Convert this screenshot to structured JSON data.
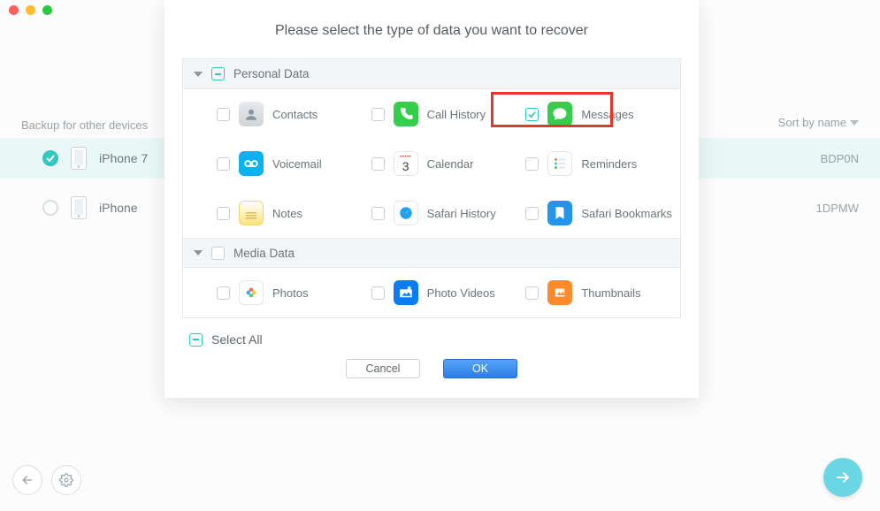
{
  "sidebar": {
    "backup_label": "Backup for other devices",
    "sort_label": "Sort by name",
    "devices": [
      {
        "name": "iPhone 7",
        "selected": true,
        "code": "BDP0N"
      },
      {
        "name": "iPhone",
        "selected": false,
        "code": "1DPMW"
      }
    ]
  },
  "modal": {
    "title": "Please select the type of data you want to recover",
    "groups": [
      {
        "title": "Personal Data",
        "state": "mixed",
        "rows": [
          [
            {
              "id": "contacts",
              "label": "Contacts",
              "checked": false
            },
            {
              "id": "call-history",
              "label": "Call History",
              "checked": false
            },
            {
              "id": "messages",
              "label": "Messages",
              "checked": true,
              "highlight": true
            }
          ],
          [
            {
              "id": "voicemail",
              "label": "Voicemail",
              "checked": false
            },
            {
              "id": "calendar",
              "label": "Calendar",
              "checked": false
            },
            {
              "id": "reminders",
              "label": "Reminders",
              "checked": false
            }
          ],
          [
            {
              "id": "notes",
              "label": "Notes",
              "checked": false
            },
            {
              "id": "safari-history",
              "label": "Safari History",
              "checked": false
            },
            {
              "id": "safari-bookmarks",
              "label": "Safari Bookmarks",
              "checked": false
            }
          ]
        ]
      },
      {
        "title": "Media Data",
        "state": "unchecked",
        "rows": [
          [
            {
              "id": "photos",
              "label": "Photos",
              "checked": false
            },
            {
              "id": "photo-videos",
              "label": "Photo Videos",
              "checked": false
            },
            {
              "id": "thumbnails",
              "label": "Thumbnails",
              "checked": false
            }
          ]
        ]
      }
    ],
    "select_all": "Select All",
    "buttons": {
      "cancel": "Cancel",
      "ok": "OK"
    }
  }
}
